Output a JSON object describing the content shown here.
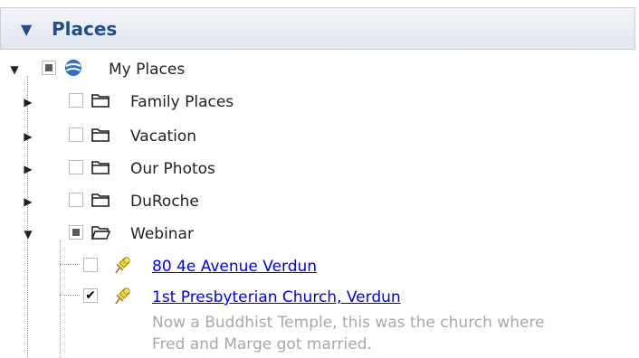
{
  "panel": {
    "title": "Places",
    "collapse_icon": "triangle-down-icon"
  },
  "tree": {
    "root": {
      "label": "My Places",
      "icon": "globe-icon",
      "checkbox": "partial",
      "expanded": true
    },
    "folders": [
      {
        "label": "Family Places",
        "icon": "folder-icon",
        "checked": false,
        "expanded": false
      },
      {
        "label": "Vacation",
        "icon": "folder-icon",
        "checked": false,
        "expanded": false
      },
      {
        "label": "Our Photos",
        "icon": "folder-icon",
        "checked": false,
        "expanded": false
      },
      {
        "label": "DuRoche",
        "icon": "folder-icon",
        "checked": false,
        "expanded": false
      },
      {
        "label": "Webinar",
        "icon": "folder-open-icon",
        "checkbox": "partial",
        "expanded": true
      }
    ],
    "placemarks": [
      {
        "label": "80 4e Avenue Verdun",
        "icon": "yellow-pushpin-icon",
        "checked": false
      },
      {
        "label": "1st Presbyterian Church, Verdun",
        "icon": "yellow-pushpin-icon",
        "checked": true,
        "description_line1": "Now a Buddhist Temple, this was the church where",
        "description_line2": "Fred and Marge got married."
      }
    ]
  },
  "colors": {
    "header_text": "#1f4e8c",
    "link": "#0000ee",
    "description": "#a8a8a8",
    "pin": "#f2d21a"
  }
}
